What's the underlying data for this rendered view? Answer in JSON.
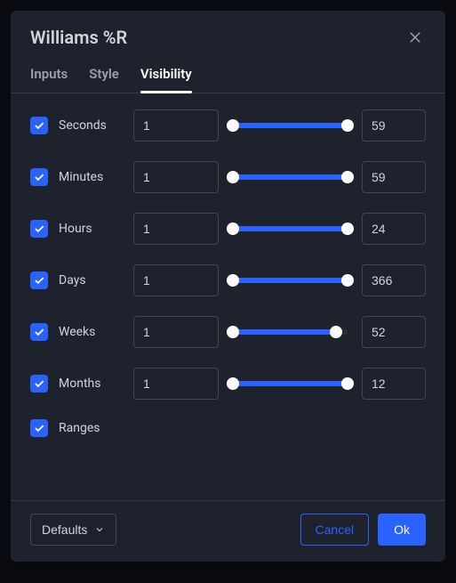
{
  "dialog": {
    "title": "Williams %R",
    "tabs": [
      {
        "label": "Inputs",
        "active": false
      },
      {
        "label": "Style",
        "active": false
      },
      {
        "label": "Visibility",
        "active": true
      }
    ],
    "rows": [
      {
        "label": "Seconds",
        "checked": true,
        "min": "1",
        "max": "59",
        "fillLeft": 0,
        "fillRight": 100
      },
      {
        "label": "Minutes",
        "checked": true,
        "min": "1",
        "max": "59",
        "fillLeft": 0,
        "fillRight": 100
      },
      {
        "label": "Hours",
        "checked": true,
        "min": "1",
        "max": "24",
        "fillLeft": 0,
        "fillRight": 100
      },
      {
        "label": "Days",
        "checked": true,
        "min": "1",
        "max": "366",
        "fillLeft": 0,
        "fillRight": 100
      },
      {
        "label": "Weeks",
        "checked": true,
        "min": "1",
        "max": "52",
        "fillLeft": 0,
        "fillRight": 90
      },
      {
        "label": "Months",
        "checked": true,
        "min": "1",
        "max": "12",
        "fillLeft": 0,
        "fillRight": 100
      },
      {
        "label": "Ranges",
        "checked": true,
        "noRange": true
      }
    ],
    "footer": {
      "defaults": "Defaults",
      "cancel": "Cancel",
      "ok": "Ok"
    }
  }
}
